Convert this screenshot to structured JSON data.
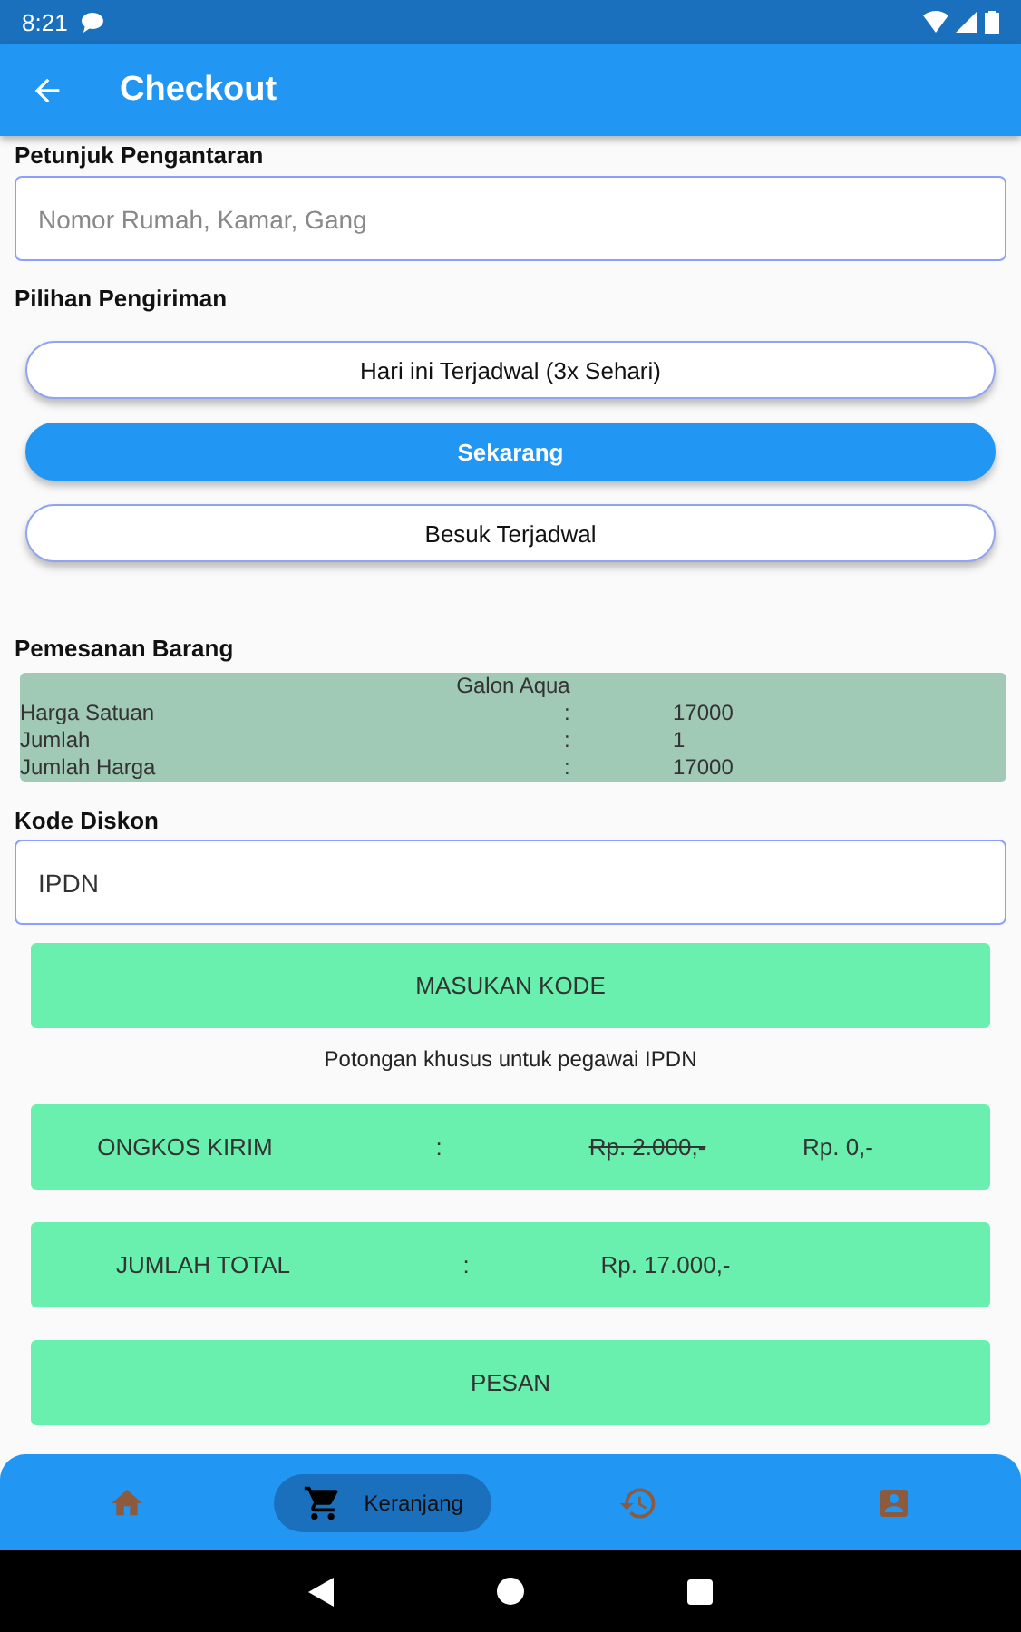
{
  "status_bar": {
    "time": "8:21"
  },
  "app_bar": {
    "title": "Checkout"
  },
  "delivery_note": {
    "label": "Petunjuk Pengantaran",
    "placeholder": "Nomor Rumah, Kamar, Gang"
  },
  "shipping": {
    "label": "Pilihan Pengiriman",
    "options": [
      {
        "label": "Hari ini Terjadwal (3x Sehari)",
        "selected": false
      },
      {
        "label": "Sekarang",
        "selected": true
      },
      {
        "label": "Besuk Terjadwal",
        "selected": false
      }
    ]
  },
  "order": {
    "label": "Pemesanan Barang",
    "product": "Galon Aqua",
    "rows": [
      {
        "label": "Harga Satuan",
        "separator": ":",
        "value": "17000"
      },
      {
        "label": "Jumlah",
        "separator": ":",
        "value": "1"
      },
      {
        "label": "Jumlah Harga",
        "separator": ":",
        "value": "17000"
      }
    ]
  },
  "discount": {
    "label": "Kode Diskon",
    "value": "IPDN",
    "button": "MASUKAN KODE",
    "note": "Potongan khusus untuk pegawai IPDN"
  },
  "shipping_cost": {
    "label": "ONGKOS KIRIM",
    "separator": ":",
    "old_price": "Rp. 2.000,-",
    "price": "Rp. 0,-"
  },
  "total": {
    "label": "JUMLAH TOTAL",
    "separator": ":",
    "price": "Rp. 17.000,-"
  },
  "order_button": "PESAN",
  "bottom_nav": [
    {
      "kind": "home",
      "selected": false
    },
    {
      "kind": "cart",
      "label": "Keranjang",
      "selected": true
    },
    {
      "kind": "history",
      "selected": false
    },
    {
      "kind": "account",
      "selected": false
    }
  ]
}
